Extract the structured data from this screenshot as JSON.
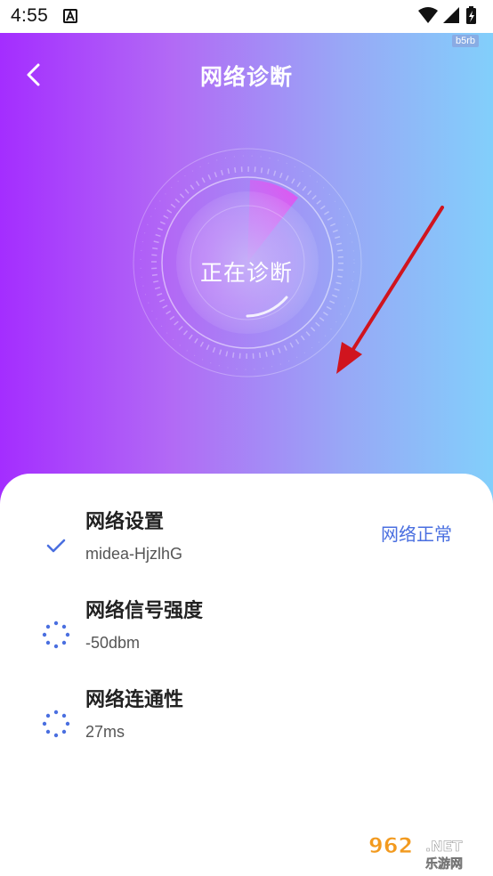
{
  "status_bar": {
    "time": "4:55",
    "icons": [
      "a-notification-icon",
      "wifi-icon",
      "cellular-signal-icon",
      "battery-charging-icon"
    ]
  },
  "header": {
    "title": "网络诊断",
    "corner_tag": "b5rb",
    "back_icon": "chevron-left-icon"
  },
  "radar": {
    "label": "正在诊断"
  },
  "checks": [
    {
      "title": "网络设置",
      "value": "midea-HjzlhG",
      "status": "网络正常",
      "state": "done",
      "icon": "check-icon"
    },
    {
      "title": "网络信号强度",
      "value": "-50dbm",
      "status": "",
      "state": "loading",
      "icon": "loading-spinner-icon"
    },
    {
      "title": "网络连通性",
      "value": "27ms",
      "status": "",
      "state": "loading",
      "icon": "loading-spinner-icon"
    }
  ],
  "watermark": {
    "top_text": "962",
    "net_text": ".NET",
    "bottom_text": "乐游网"
  },
  "colors": {
    "gradient_start": "#a42dff",
    "gradient_end": "#82cffb",
    "accent_blue": "#4a6fe0",
    "annotation_red": "#d0141e"
  }
}
